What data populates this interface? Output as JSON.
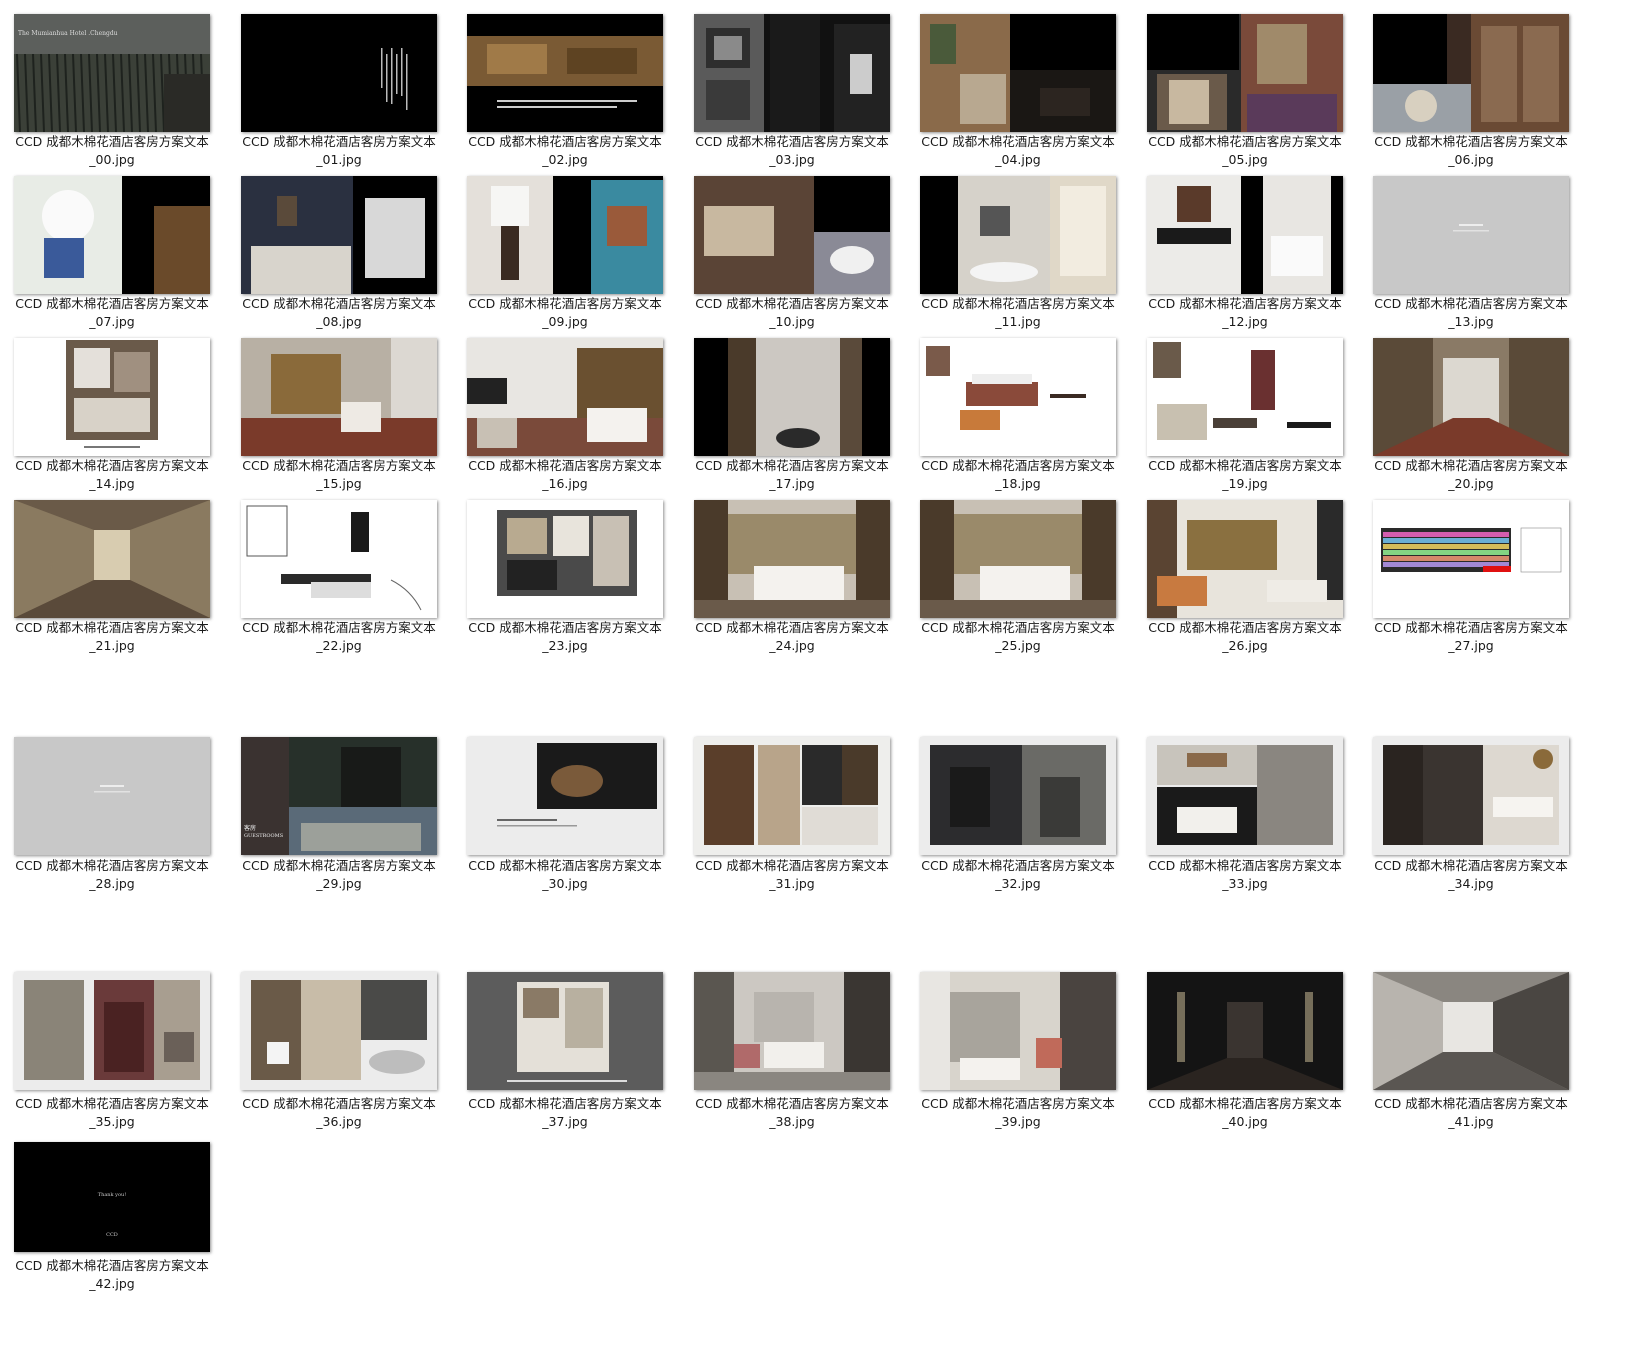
{
  "items": [
    {
      "line1": "CCD 成都木棉花酒店客房方案文本",
      "line2": "_00.jpg",
      "thumb": "cover"
    },
    {
      "line1": "CCD 成都木棉花酒店客房方案文本",
      "line2": "_01.jpg",
      "thumb": "black-text"
    },
    {
      "line1": "CCD 成都木棉花酒店客房方案文本",
      "line2": "_02.jpg",
      "thumb": "scroll-painting"
    },
    {
      "line1": "CCD 成都木棉花酒店客房方案文本",
      "line2": "_03.jpg",
      "thumb": "aerial-bw"
    },
    {
      "line1": "CCD 成都木棉花酒店客房方案文本",
      "line2": "_04.jpg",
      "thumb": "collage-dark"
    },
    {
      "line1": "CCD 成都木棉花酒店客房方案文本",
      "line2": "_05.jpg",
      "thumb": "collage-art"
    },
    {
      "line1": "CCD 成都木棉花酒店客房方案文本",
      "line2": "_06.jpg",
      "thumb": "teapot-cabinet"
    },
    {
      "line1": "CCD 成都木棉花酒店客房方案文本",
      "line2": "_07.jpg",
      "thumb": "flowers"
    },
    {
      "line1": "CCD 成都木棉花酒店客房方案文本",
      "line2": "_08.jpg",
      "thumb": "bedroom-photo"
    },
    {
      "line1": "CCD 成都木棉花酒店客房方案文本",
      "line2": "_09.jpg",
      "thumb": "lamp-blue"
    },
    {
      "line1": "CCD 成都木棉花酒店客房方案文本",
      "line2": "_10.jpg",
      "thumb": "teacup"
    },
    {
      "line1": "CCD 成都木棉花酒店客房方案文本",
      "line2": "_11.jpg",
      "thumb": "bathroom-window"
    },
    {
      "line1": "CCD 成都木棉花酒店客房方案文本",
      "line2": "_12.jpg",
      "thumb": "vanity-towels"
    },
    {
      "line1": "CCD 成都木棉花酒店客房方案文本",
      "line2": "_13.jpg",
      "thumb": "grey-title"
    },
    {
      "line1": "CCD 成都木棉花酒店客房方案文本",
      "line2": "_14.jpg",
      "thumb": "plan"
    },
    {
      "line1": "CCD 成都木棉花酒店客房方案文本",
      "line2": "_15.jpg",
      "thumb": "render-room"
    },
    {
      "line1": "CCD 成都木棉花酒店客房方案文本",
      "line2": "_16.jpg",
      "thumb": "render-room2"
    },
    {
      "line1": "CCD 成都木棉花酒店客房方案文本",
      "line2": "_17.jpg",
      "thumb": "render-bath"
    },
    {
      "line1": "CCD 成都木棉花酒店客房方案文本",
      "line2": "_18.jpg",
      "thumb": "furniture-board"
    },
    {
      "line1": "CCD 成都木棉花酒店客房方案文本",
      "line2": "_19.jpg",
      "thumb": "furniture-board2"
    },
    {
      "line1": "CCD 成都木棉花酒店客房方案文本",
      "line2": "_20.jpg",
      "thumb": "corridor-render"
    },
    {
      "line1": "CCD 成都木棉花酒店客房方案文本",
      "line2": "_21.jpg",
      "thumb": "corridor"
    },
    {
      "line1": "CCD 成都木棉花酒店客房方案文本",
      "line2": "_22.jpg",
      "thumb": "sketch-board"
    },
    {
      "line1": "CCD 成都木棉花酒店客房方案文本",
      "line2": "_23.jpg",
      "thumb": "plan-wide"
    },
    {
      "line1": "CCD 成都木棉花酒店客房方案文本",
      "line2": "_24.jpg",
      "thumb": "render-bed"
    },
    {
      "line1": "CCD 成都木棉花酒店客房方案文本",
      "line2": "_25.jpg",
      "thumb": "render-bed"
    },
    {
      "line1": "CCD 成都木棉花酒店客房方案文本",
      "line2": "_26.jpg",
      "thumb": "render-living"
    },
    {
      "line1": "CCD 成都木棉花酒店客房方案文本",
      "line2": "_27.jpg",
      "thumb": "table-sheet"
    },
    {
      "line1": "CCD 成都木棉花酒店客房方案文本",
      "line2": "_28.jpg",
      "thumb": "grey-title"
    },
    {
      "line1": "CCD 成都木棉花酒店客房方案文本",
      "line2": "_29.jpg",
      "thumb": "guestroom-cover"
    },
    {
      "line1": "CCD 成都木棉花酒店客房方案文本",
      "line2": "_30.jpg",
      "thumb": "light-collage"
    },
    {
      "line1": "CCD 成都木棉花酒店客房方案文本",
      "line2": "_31.jpg",
      "thumb": "wood-collage"
    },
    {
      "line1": "CCD 成都木棉花酒店客房方案文本",
      "line2": "_32.jpg",
      "thumb": "dark-collage"
    },
    {
      "line1": "CCD 成都木棉花酒店客房方案文本",
      "line2": "_33.jpg",
      "thumb": "brick-collage"
    },
    {
      "line1": "CCD 成都木棉花酒店客房方案文本",
      "line2": "_34.jpg",
      "thumb": "modern-collage"
    },
    {
      "line1": "CCD 成都木棉花酒店客房方案文本",
      "line2": "_35.jpg",
      "thumb": "cabinet-collage"
    },
    {
      "line1": "CCD 成都木棉花酒店客房方案文本",
      "line2": "_36.jpg",
      "thumb": "bath-collage"
    },
    {
      "line1": "CCD 成都木棉花酒店客房方案文本",
      "line2": "_37.jpg",
      "thumb": "plan-dark"
    },
    {
      "line1": "CCD 成都木棉花酒店客房方案文本",
      "line2": "_38.jpg",
      "thumb": "modern-room"
    },
    {
      "line1": "CCD 成都木棉花酒店客房方案文本",
      "line2": "_39.jpg",
      "thumb": "modern-room2"
    },
    {
      "line1": "CCD 成都木棉花酒店客房方案文本",
      "line2": "_40.jpg",
      "thumb": "dark-corridor"
    },
    {
      "line1": "CCD 成都木棉花酒店客房方案文本",
      "line2": "_41.jpg",
      "thumb": "grey-corridor"
    },
    {
      "line1": "CCD 成都木棉花酒店客房方案文本",
      "line2": "_42.jpg",
      "thumb": "thankyou"
    }
  ],
  "thumb_text": {
    "cover_title": "The Mumianhua Hotel .Chengdu",
    "guestroom_cn": "客房",
    "guestroom_en": "GUESTROOMS",
    "thankyou": "Thank you!",
    "thankyou_brand": "CCD"
  }
}
